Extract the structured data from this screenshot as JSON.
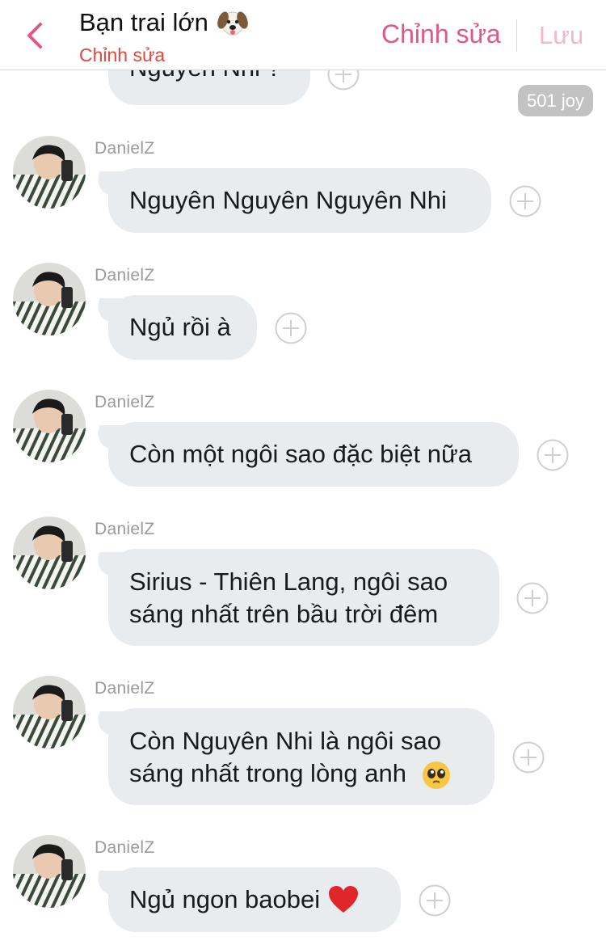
{
  "header": {
    "title": "Bạn trai lớn",
    "subtitle": "Chỉnh sửa",
    "edit_label": "Chỉnh sửa",
    "save_label": "Lưu"
  },
  "badge": "501 joy",
  "partial_message": "Nguyên Nhi ?",
  "messages": [
    {
      "sender": "DanielZ",
      "text": "Nguyên Nguyên Nguyên Nhi"
    },
    {
      "sender": "DanielZ",
      "text": "Ngủ rồi à"
    },
    {
      "sender": "DanielZ",
      "text": "Còn một ngôi sao đặc biệt nữa"
    },
    {
      "sender": "DanielZ",
      "lines": [
        "Sirius - Thiên Lang, ngôi sao",
        "sáng nhất trên bầu trời đêm"
      ]
    },
    {
      "sender": "DanielZ",
      "lines": [
        "Còn Nguyên Nhi là ngôi sao",
        "sáng nhất trong lòng anh"
      ],
      "emoji": "pleading-face-icon"
    },
    {
      "sender": "DanielZ",
      "text": "Ngủ ngon baobei",
      "emoji": "red-heart-icon"
    }
  ],
  "colors": {
    "accent": "#e2578b",
    "subtitle": "#e0473f",
    "bubble": "#e9ecef",
    "badge": "#c2c2c2"
  }
}
